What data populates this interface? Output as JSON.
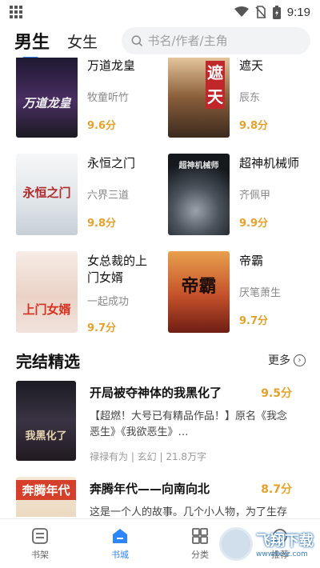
{
  "status": {
    "time": "9:19"
  },
  "header": {
    "tabs": [
      {
        "label": "男生"
      },
      {
        "label": "女生"
      }
    ],
    "search_placeholder": "书名/作者/主角"
  },
  "books": [
    {
      "title": "万道龙皇",
      "author": "牧童听竹",
      "score": "9.6分",
      "cover_text": "万道龙皇",
      "cover_color": "#3a2c4a"
    },
    {
      "title": "遮天",
      "author": "辰东",
      "score": "9.8分",
      "cover_text": "遮天",
      "cover_color": "#7a5a3c"
    },
    {
      "title": "永恒之门",
      "author": "六界三道",
      "score": "9.8分",
      "cover_text": "永恒之门",
      "cover_color": "#e9ecef"
    },
    {
      "title": "超神机械师",
      "author": "齐佩甲",
      "score": "9.9分",
      "cover_text": "超神机械师",
      "cover_color": "#2a2f35"
    },
    {
      "title": "女总裁的上门女婿",
      "author": "一起成功",
      "score": "9.7分",
      "cover_text": "上门女婿",
      "cover_color": "#f3e4dc"
    },
    {
      "title": "帝霸",
      "author": "厌笔萧生",
      "score": "9.7分",
      "cover_text": "帝霸",
      "cover_color": "#c46a2a"
    }
  ],
  "section": {
    "title": "完结精选",
    "more_label": "更多"
  },
  "finished": [
    {
      "title": "开局被夺神体的我黑化了",
      "score": "9.5分",
      "desc": "【超燃！大号已有精品作品！】原名《我念恶生》《我欲恶生》…",
      "meta": "禄禄有为 | 玄幻 | 21.8万字",
      "cover_text": "我黑化了",
      "cover_color": "#2b2b33"
    },
    {
      "title": "奔腾年代——向南向北",
      "score": "8.7分",
      "desc": "这是一个人的故事。几个小人物，为了生存和理想，他们在努力进取，奋斗",
      "meta": "",
      "cover_text": "奔腾年代",
      "cover_color": "#d6402b"
    }
  ],
  "nav": [
    {
      "label": "书架",
      "icon": "bookshelf-icon"
    },
    {
      "label": "书城",
      "icon": "bookstore-icon"
    },
    {
      "label": "分类",
      "icon": "category-icon"
    },
    {
      "label": "推荐",
      "icon": "recommend-icon"
    }
  ],
  "watermark": {
    "text": "飞翔下载",
    "url": "www.fxxz.com"
  },
  "colors": {
    "accent": "#2d86ff",
    "score": "#e5a22a"
  }
}
